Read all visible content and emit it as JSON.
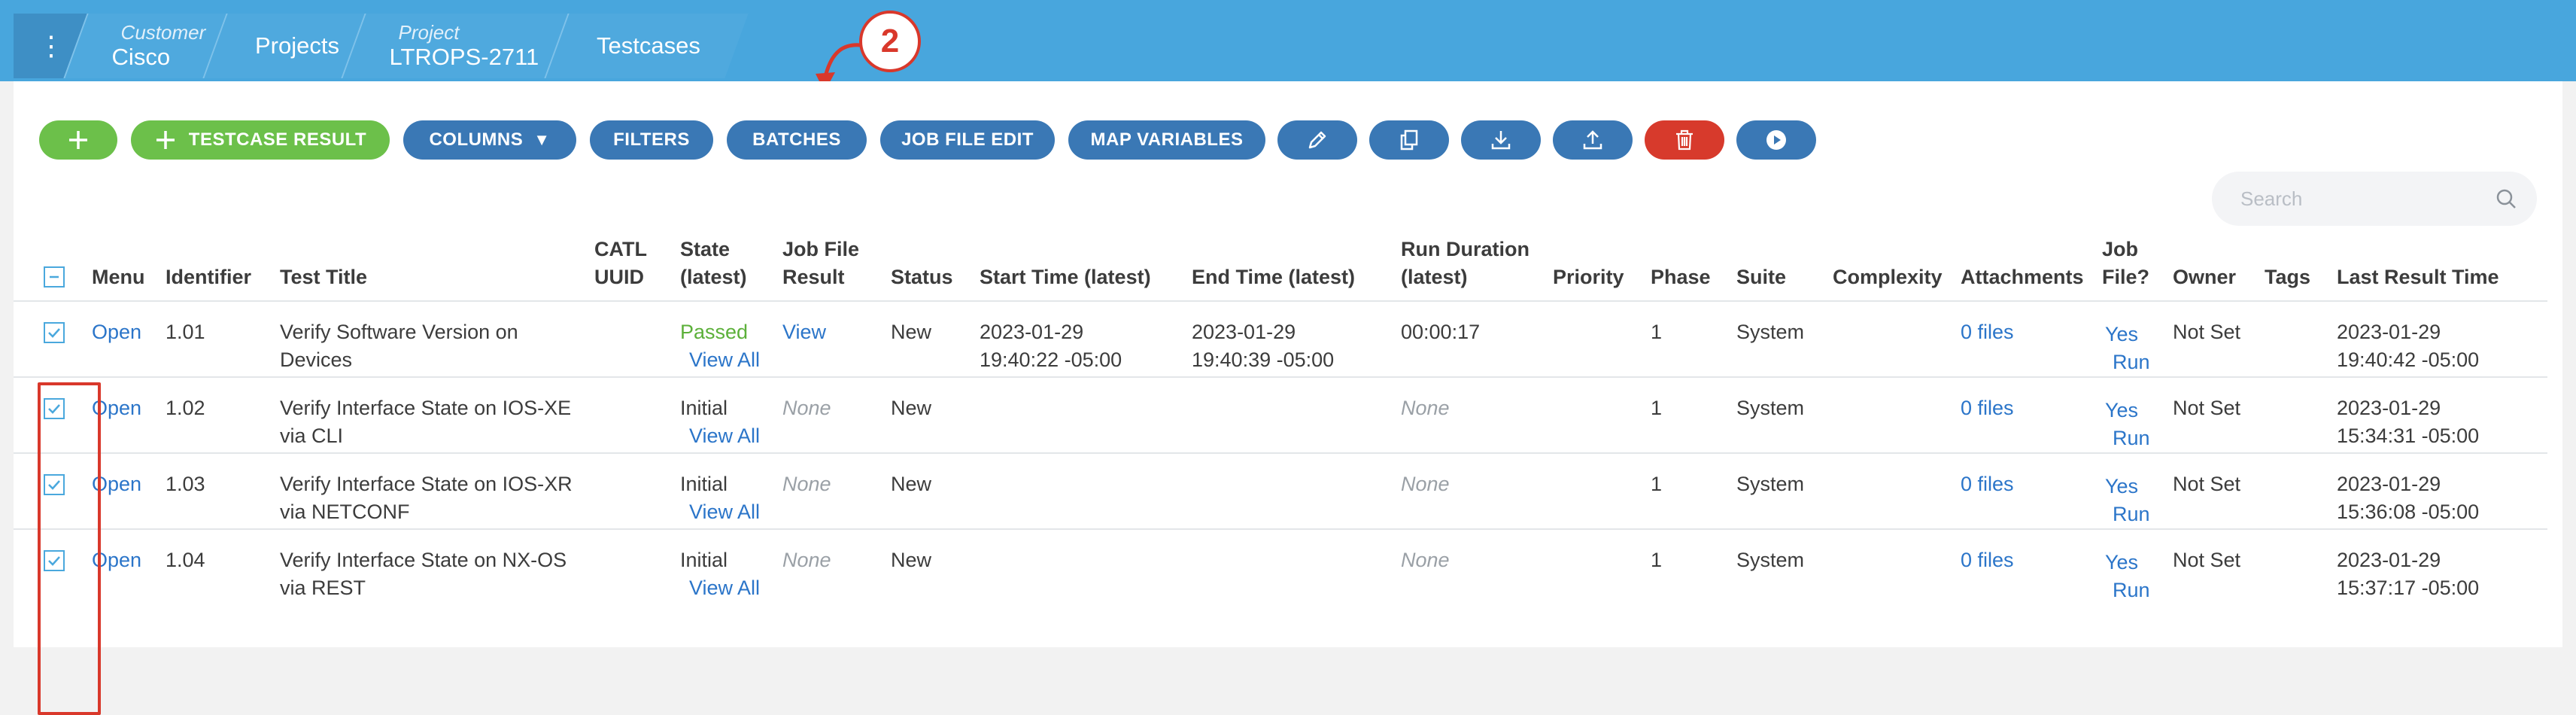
{
  "breadcrumb": {
    "menu_icon": "kebab-menu-icon",
    "items": [
      {
        "label": "Customer",
        "value": "Cisco"
      },
      {
        "label": "",
        "value": "Projects"
      },
      {
        "label": "Project",
        "value": "LTROPS-2711"
      },
      {
        "label": "",
        "value": "Testcases"
      }
    ]
  },
  "toolbar": {
    "add_icon": "plus-icon",
    "testcase_result": "TESTCASE RESULT",
    "columns": "COLUMNS",
    "columns_caret": "▼",
    "filters": "FILTERS",
    "batches": "BATCHES",
    "job_file_edit": "JOB FILE EDIT",
    "map_variables": "MAP VARIABLES",
    "icons": [
      "pencil-icon",
      "copy-icon",
      "download-icon",
      "upload-icon",
      "trash-icon",
      "play-icon"
    ]
  },
  "search": {
    "placeholder": "Search",
    "value": ""
  },
  "annotation": {
    "callout_number": "2"
  },
  "table": {
    "headers": {
      "menu": "Menu",
      "identifier": "Identifier",
      "title": "Test Title",
      "catl_1": "CATL",
      "catl_2": "UUID",
      "state_1": "State",
      "state_2": "(latest)",
      "jobfile_1": "Job File",
      "jobfile_2": "Result",
      "status": "Status",
      "start": "Start Time (latest)",
      "end": "End Time (latest)",
      "duration_1": "Run Duration",
      "duration_2": "(latest)",
      "priority": "Priority",
      "phase": "Phase",
      "suite": "Suite",
      "complexity": "Complexity",
      "attachments": "Attachments",
      "jobq_1": "Job",
      "jobq_2": "File?",
      "owner": "Owner",
      "tags": "Tags",
      "last": "Last Result Time"
    },
    "rows": [
      {
        "menu": "Open",
        "identifier": "1.01",
        "title_1": "Verify Software Version on",
        "title_2": "Devices",
        "catl": "",
        "state": "Passed",
        "view_all": "View All",
        "job_result": "View",
        "status": "New",
        "start_1": "2023-01-29",
        "start_2": "19:40:22 -05:00",
        "end_1": "2023-01-29",
        "end_2": "19:40:39 -05:00",
        "duration": "00:00:17",
        "priority": "",
        "phase": "1",
        "suite": "System",
        "complexity": "",
        "attachments": "0 files",
        "job_file": "Yes",
        "run": "Run",
        "owner": "Not Set",
        "tags": "",
        "last_1": "2023-01-29",
        "last_2": "19:40:42 -05:00",
        "checked": true
      },
      {
        "menu": "Open",
        "identifier": "1.02",
        "title_1": "Verify Interface State on IOS-XE",
        "title_2": "via CLI",
        "catl": "",
        "state": "Initial",
        "view_all": "View All",
        "job_result": "None",
        "status": "New",
        "start_1": "",
        "start_2": "",
        "end_1": "",
        "end_2": "",
        "duration": "None",
        "priority": "",
        "phase": "1",
        "suite": "System",
        "complexity": "",
        "attachments": "0 files",
        "job_file": "Yes",
        "run": "Run",
        "owner": "Not Set",
        "tags": "",
        "last_1": "2023-01-29",
        "last_2": "15:34:31 -05:00",
        "checked": true
      },
      {
        "menu": "Open",
        "identifier": "1.03",
        "title_1": "Verify Interface State on IOS-XR",
        "title_2": "via NETCONF",
        "catl": "",
        "state": "Initial",
        "view_all": "View All",
        "job_result": "None",
        "status": "New",
        "start_1": "",
        "start_2": "",
        "end_1": "",
        "end_2": "",
        "duration": "None",
        "priority": "",
        "phase": "1",
        "suite": "System",
        "complexity": "",
        "attachments": "0 files",
        "job_file": "Yes",
        "run": "Run",
        "owner": "Not Set",
        "tags": "",
        "last_1": "2023-01-29",
        "last_2": "15:36:08 -05:00",
        "checked": true
      },
      {
        "menu": "Open",
        "identifier": "1.04",
        "title_1": "Verify Interface State on NX-OS",
        "title_2": "via REST",
        "catl": "",
        "state": "Initial",
        "view_all": "View All",
        "job_result": "None",
        "status": "New",
        "start_1": "",
        "start_2": "",
        "end_1": "",
        "end_2": "",
        "duration": "None",
        "priority": "",
        "phase": "1",
        "suite": "System",
        "complexity": "",
        "attachments": "0 files",
        "job_file": "Yes",
        "run": "Run",
        "owner": "Not Set",
        "tags": "",
        "last_1": "2023-01-29",
        "last_2": "15:37:17 -05:00",
        "checked": true
      }
    ]
  },
  "colors": {
    "header_bar": "#48a6dd",
    "primary_button": "#3a78b5",
    "add_button": "#6cc04a",
    "delete_button": "#d73a2c",
    "link": "#2b75c9",
    "passed": "#5cb03a",
    "annotation": "#d9382b"
  }
}
